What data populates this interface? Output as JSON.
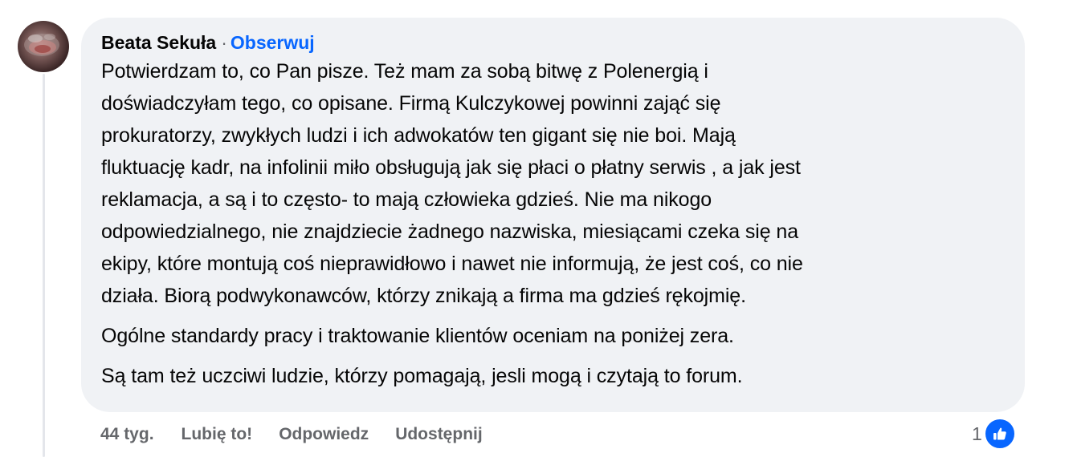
{
  "comment": {
    "author": "Beata Sekuła",
    "separator": "·",
    "follow_label": "Obserwuj",
    "paragraphs": [
      "Potwierdzam to, co Pan pisze. Też mam za sobą bitwę z Polenergią i\ndoświadczyłam tego, co opisane. Firmą Kulczykowej powinni zająć się\nprokuratorzy, zwykłych ludzi i ich adwokatów ten gigant się nie boi. Mają\nfluktuację kadr, na infolinii miło obsługują jak się płaci o płatny serwis , a jak jest\nreklamacja, a są i to często- to mają człowieka gdzieś. Nie ma nikogo\nodpowiedzialnego, nie znajdziecie żadnego nazwiska, miesiącami czeka się na\nekipy, które montują coś nieprawidłowo i nawet nie informują, że jest coś, co nie\ndziała. Biorą podwykonawców, którzy znikają a firma ma gdzieś rękojmię.",
      "Ogólne standardy pracy i traktowanie klientów oceniam na poniżej zera.",
      "Są tam też uczciwi ludzie, którzy pomagają, jesli mogą i czytają to forum."
    ],
    "time": "44 tyg.",
    "actions": {
      "like": "Lubię to!",
      "reply": "Odpowiedz",
      "share": "Udostępnij"
    },
    "reaction_count": "1",
    "reaction_icon": "like-thumb-icon"
  },
  "colors": {
    "bubble": "#f0f2f5",
    "link": "#0866ff",
    "secondary_text": "#65676b",
    "like_badge": "#0866ff"
  }
}
